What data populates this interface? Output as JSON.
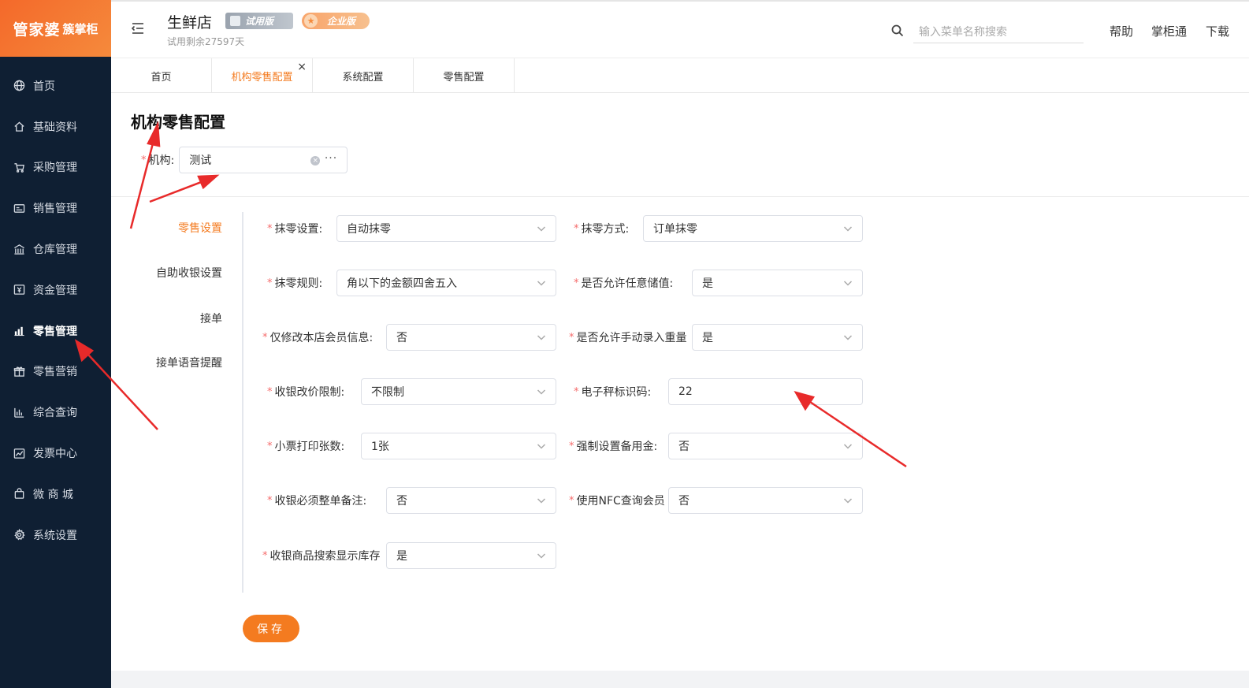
{
  "logo": {
    "main": "管家婆",
    "sub": "簇掌柜"
  },
  "sidebar": {
    "items": [
      {
        "label": "首页",
        "icon": "globe-icon"
      },
      {
        "label": "基础资料",
        "icon": "home-icon"
      },
      {
        "label": "采购管理",
        "icon": "cart-icon"
      },
      {
        "label": "销售管理",
        "icon": "sales-icon"
      },
      {
        "label": "仓库管理",
        "icon": "warehouse-icon"
      },
      {
        "label": "资金管理",
        "icon": "money-icon"
      },
      {
        "label": "零售管理",
        "icon": "bar-chart-icon"
      },
      {
        "label": "零售营销",
        "icon": "gift-icon"
      },
      {
        "label": "综合查询",
        "icon": "stats-icon"
      },
      {
        "label": "发票中心",
        "icon": "trend-icon"
      },
      {
        "label": "微 商 城",
        "icon": "bag-icon"
      },
      {
        "label": "系统设置",
        "icon": "gear-icon"
      }
    ],
    "active_index": 6
  },
  "header": {
    "store_name": "生鲜店",
    "trial_badge": "试用版",
    "enterprise_badge": "企业版",
    "trial_left": "试用剩余27597天",
    "search_placeholder": "输入菜单名称搜索",
    "links": {
      "help": "帮助",
      "app": "掌柜通",
      "download": "下载"
    }
  },
  "tabs": [
    {
      "label": "首页",
      "active": false
    },
    {
      "label": "机构零售配置",
      "active": true,
      "close": "×"
    },
    {
      "label": "系统配置",
      "active": false
    },
    {
      "label": "零售配置",
      "active": false
    }
  ],
  "page": {
    "title": "机构零售配置",
    "org_label": "机构:",
    "org_value": "测试",
    "org_more": "···",
    "org_clear": "×",
    "required_mark": "*",
    "side_tabs": [
      "零售设置",
      "自助收银设置",
      "接单",
      "接单语音提醒"
    ],
    "save_label": "保存"
  },
  "form": {
    "rounding_setting": {
      "label": "抹零设置:",
      "value": "自动抹零"
    },
    "rounding_method": {
      "label": "抹零方式:",
      "value": "订单抹零"
    },
    "rounding_rule": {
      "label": "抹零规则:",
      "value": "角以下的金额四舍五入"
    },
    "allow_any_stored_value": {
      "label": "是否允许任意储值:",
      "value": "是"
    },
    "only_modify_store_member": {
      "label": "仅修改本店会员信息:",
      "value": "否"
    },
    "allow_manual_weight": {
      "label": "是否允许手动录入重量",
      "value": "是"
    },
    "price_change_limit": {
      "label": "收银改价限制:",
      "value": "不限制"
    },
    "scale_code": {
      "label": "电子秤标识码:",
      "value": "22"
    },
    "receipt_copies": {
      "label": "小票打印张数:",
      "value": "1张"
    },
    "force_petty_cash": {
      "label": "强制设置备用金:",
      "value": "否"
    },
    "require_order_note": {
      "label": "收银必须整单备注:",
      "value": "否"
    },
    "nfc_member_query": {
      "label": "使用NFC查询会员",
      "value": "否"
    },
    "search_show_stock": {
      "label": "收银商品搜索显示库存",
      "value": "是"
    }
  }
}
